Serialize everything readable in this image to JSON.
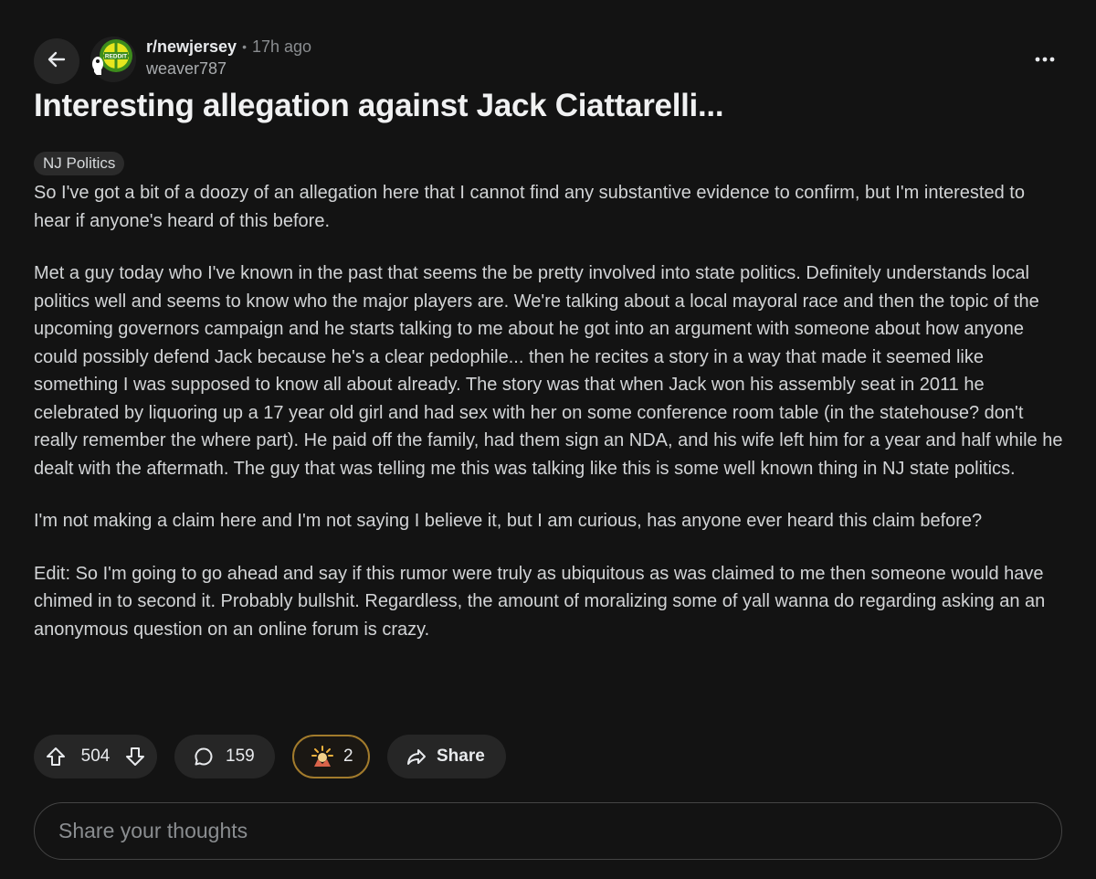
{
  "post": {
    "subreddit": "r/newjersey",
    "separator": "•",
    "time_ago": "17h ago",
    "author": "weaver787",
    "avatar_text": "REDDIT",
    "title": "Interesting allegation against Jack Ciattarelli...",
    "flair": "NJ Politics",
    "body": [
      "So I've got a bit of a doozy of an allegation here that I cannot find any substantive evidence to confirm, but I'm interested to hear if anyone's heard of this before.",
      "Met a guy today who I've known in the past that seems the be pretty involved into state politics. Definitely understands local politics well and seems to know who the major players are. We're talking about a local mayoral race and then the topic of the upcoming governors campaign and he starts talking to me about he got into an argument with someone about how anyone could possibly defend Jack because he's a clear pedophile... then he recites a story in a way that made it seemed like something I was supposed to know all about already. The story was that when Jack won his assembly seat in 2011 he celebrated by liquoring up a 17 year old girl and had sex with her on some conference room table (in the statehouse? don't really remember the where part). He paid off the family, had them sign an NDA, and his wife left him for a year and half while he dealt with the aftermath. The guy that was telling me this was talking like this is some well known thing in NJ state politics.",
      "I'm not making a claim here and I'm not saying I believe it, but I am curious, has anyone ever heard this claim before?",
      "Edit: So I'm going to go ahead and say if this rumor were truly as ubiquitous as was claimed to me then someone would have chimed in to second it. Probably bullshit. Regardless, the amount of moralizing some of yall wanna do regarding asking an an anonymous question on an online forum is crazy."
    ]
  },
  "actions": {
    "votes": "504",
    "comments": "159",
    "awards": "2",
    "share_label": "Share"
  },
  "composer": {
    "placeholder": "Share your thoughts"
  },
  "icons": {
    "back": "arrow-left-icon",
    "more": "more-horizontal-icon",
    "upvote": "upvote-arrow-icon",
    "downvote": "downvote-arrow-icon",
    "comment": "comment-bubble-icon",
    "award": "award-icon",
    "share": "share-arrow-icon"
  },
  "colors": {
    "background": "#131313",
    "pill": "#262626",
    "award_border": "#a27b2c",
    "text": "#d7dadc",
    "muted": "#8a8d90"
  }
}
